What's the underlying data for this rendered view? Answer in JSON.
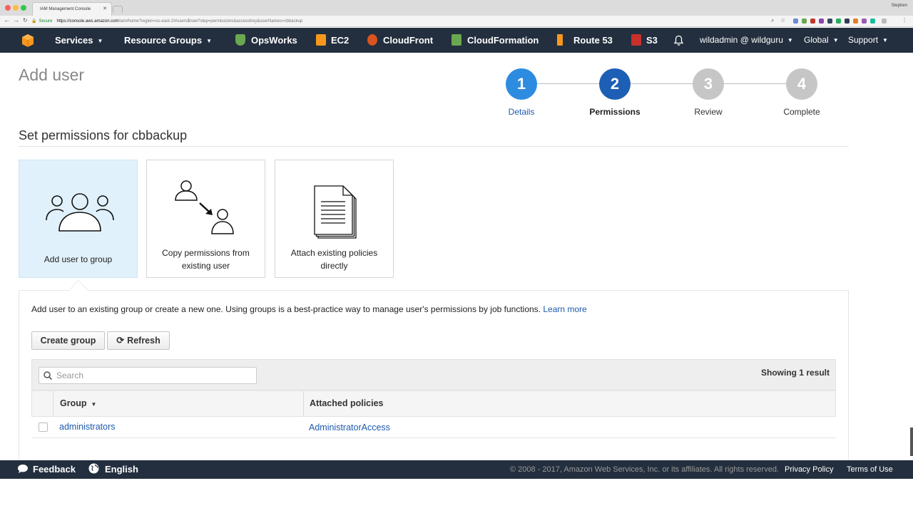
{
  "browser": {
    "tab_title": "IAM Management Console",
    "profile_name": "Stephen",
    "secure_label": "Secure",
    "url_host": "https://console.aws.amazon.com",
    "url_path": "/iam/home?region=us-east-2#/users$new?step=permissions&accessKey&userNames=cbbackup"
  },
  "nav": {
    "services": "Services",
    "resource_groups": "Resource Groups",
    "shortcuts": [
      "OpsWorks",
      "EC2",
      "CloudFront",
      "CloudFormation",
      "Route 53",
      "S3"
    ],
    "account": "wildadmin @ wildguru",
    "region": "Global",
    "support": "Support"
  },
  "page": {
    "title": "Add user",
    "subtitle": "Set permissions for cbbackup"
  },
  "steps": [
    {
      "number": "1",
      "label": "Details",
      "state": "done"
    },
    {
      "number": "2",
      "label": "Permissions",
      "state": "current"
    },
    {
      "number": "3",
      "label": "Review",
      "state": "todo"
    },
    {
      "number": "4",
      "label": "Complete",
      "state": "todo"
    }
  ],
  "options": [
    {
      "label": "Add user to group",
      "icon": "group-icon",
      "selected": true
    },
    {
      "label": "Copy permissions from existing user",
      "icon": "copy-permissions-icon",
      "selected": false
    },
    {
      "label": "Attach existing policies directly",
      "icon": "policy-document-icon",
      "selected": false
    }
  ],
  "panel": {
    "description": "Add user to an existing group or create a new one. Using groups is a best-practice way to manage user's permissions by job functions.",
    "learn_more": "Learn more",
    "create_group": "Create group",
    "refresh": "Refresh",
    "search_placeholder": "Search",
    "showing": "Showing 1 result"
  },
  "table": {
    "columns": [
      "Group",
      "Attached policies"
    ],
    "rows": [
      {
        "group": "administrators",
        "policies": "AdministratorAccess",
        "checked": false
      }
    ]
  },
  "footer": {
    "feedback": "Feedback",
    "language": "English",
    "copyright": "© 2008 - 2017, Amazon Web Services, Inc. or its affiliates. All rights reserved.",
    "privacy": "Privacy Policy",
    "terms": "Terms of Use"
  },
  "colors": {
    "aws_nav": "#232f3e",
    "step_done": "#2e8ce0",
    "step_current": "#1d5fb4",
    "step_todo": "#c6c6c6",
    "link": "#1b5aab",
    "selected_card": "#e1f1fb",
    "aws_orange": "#f7981d"
  }
}
